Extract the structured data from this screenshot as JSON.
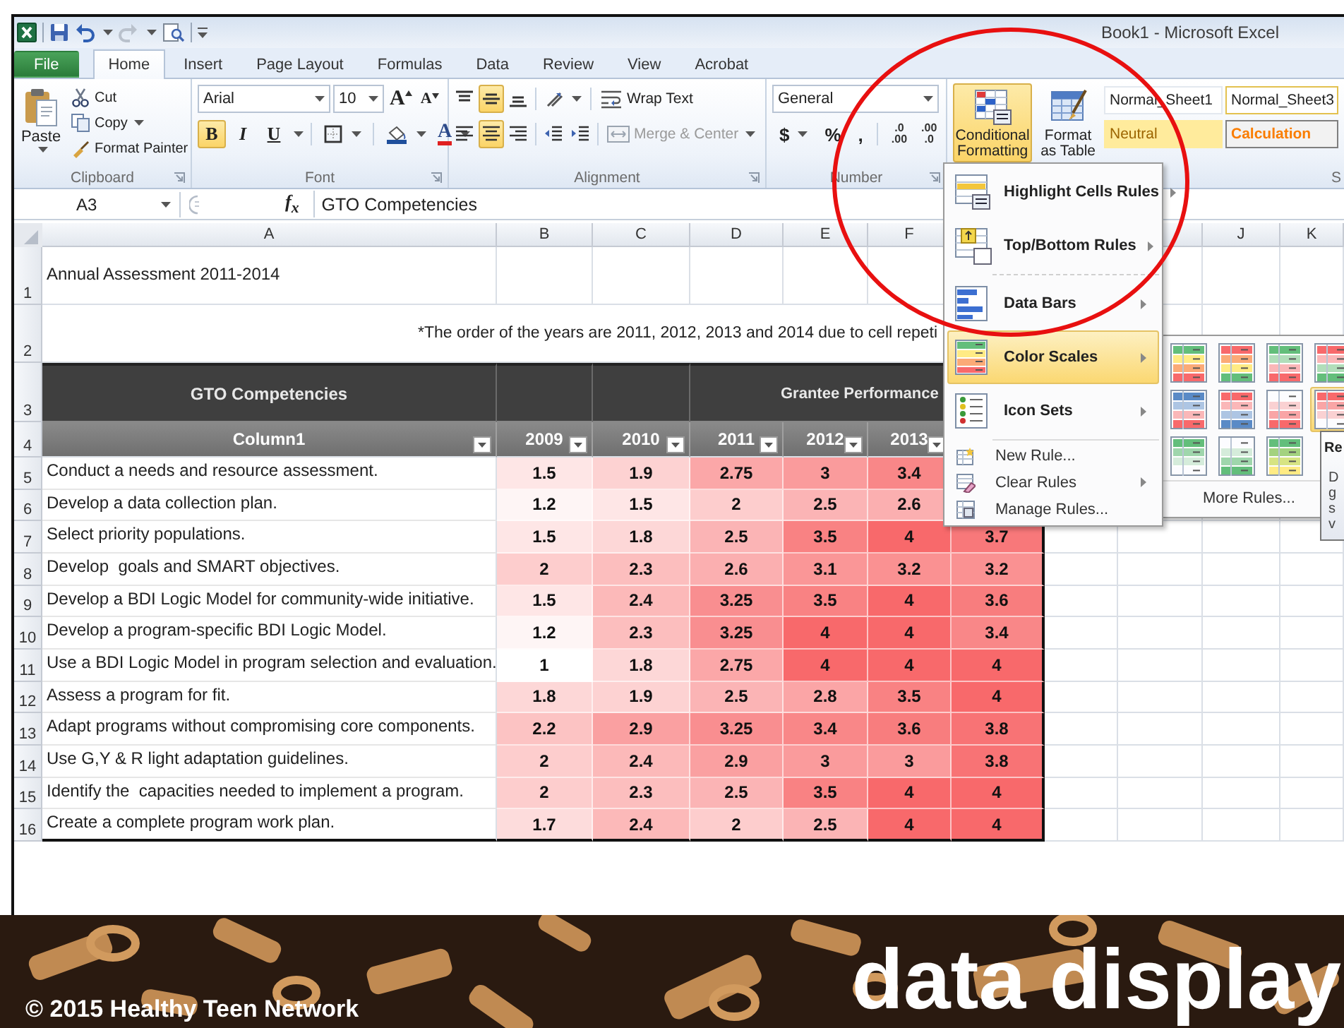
{
  "title_bar": {
    "title": "Book1  -  Microsoft Excel"
  },
  "tabs": [
    {
      "label": "File",
      "kind": "file",
      "selected": false
    },
    {
      "label": "Home",
      "kind": "tab",
      "selected": true
    },
    {
      "label": "Insert",
      "kind": "tab",
      "selected": false
    },
    {
      "label": "Page Layout",
      "kind": "tab",
      "selected": false
    },
    {
      "label": "Formulas",
      "kind": "tab",
      "selected": false
    },
    {
      "label": "Data",
      "kind": "tab",
      "selected": false
    },
    {
      "label": "Review",
      "kind": "tab",
      "selected": false
    },
    {
      "label": "View",
      "kind": "tab",
      "selected": false
    },
    {
      "label": "Acrobat",
      "kind": "tab",
      "selected": false
    }
  ],
  "clipboard": {
    "paste": "Paste",
    "cut": "Cut",
    "copy": "Copy",
    "format_painter": "Format Painter",
    "label": "Clipboard"
  },
  "font": {
    "name": "Arial",
    "size": "10",
    "grow": "A",
    "shrink": "A",
    "bold": {
      "label": "B",
      "on": true
    },
    "italic": {
      "label": "I",
      "on": false
    },
    "underline": {
      "label": "U",
      "on": false
    },
    "font_color": "A",
    "label": "Font"
  },
  "alignment": {
    "vertical": [
      {
        "selected": false
      },
      {
        "selected": true
      },
      {
        "selected": false
      }
    ],
    "horizontal": [
      {
        "selected": false
      },
      {
        "selected": true
      },
      {
        "selected": false
      }
    ],
    "wrap_text": "Wrap Text",
    "merge_center": {
      "label": "Merge & Center",
      "disabled": true
    },
    "label": "Alignment"
  },
  "number": {
    "format": "General",
    "currency": "$",
    "percent": "%",
    "comma": ",",
    "increase_decimal": [
      ".0",
      ".00"
    ],
    "decrease_decimal": [
      ".00",
      ".0"
    ],
    "label": "Number"
  },
  "styles": {
    "conditional_formatting": {
      "label": "Conditional Formatting",
      "active": true
    },
    "format_as_table": "Format as Table",
    "cell_styles": [
      {
        "label": "Normal_Sheet1",
        "kind": "normal",
        "selected": false
      },
      {
        "label": "Normal_Sheet3",
        "kind": "normal",
        "selected": true
      },
      {
        "label": "Neutral",
        "kind": "neutral",
        "selected": false
      },
      {
        "label": "Calculation",
        "kind": "calculation",
        "selected": false
      }
    ],
    "label": "S"
  },
  "formula_bar": {
    "name_box": "A3",
    "function_label": "f$_{x}$",
    "value": "GTO Competencies"
  },
  "column_header_bar": {
    "letters": [
      "A",
      "B",
      "C",
      "D",
      "E",
      "F",
      "J",
      "K"
    ]
  },
  "row_header_bar": {
    "numbers": [
      "1",
      "2",
      "3",
      "4",
      "5",
      "6",
      "7",
      "8",
      "9",
      "10",
      "11",
      "12",
      "13",
      "14",
      "15",
      "16"
    ]
  },
  "sheet": {
    "title": "Annual Assessment 2011-2014",
    "note": "*The order of the years are 2011, 2012, 2013 and 2014 due to cell repeti",
    "group_headers": [
      "GTO Competencies",
      "Grantee Performance"
    ],
    "column_headers": [
      "Column1",
      "2009",
      "2010",
      "2011",
      "2012",
      "2013"
    ],
    "rows": [
      {
        "label": "Conduct a needs and resource assessment.",
        "cells": [
          {
            "value": "1.5",
            "color": "#fee6e6"
          },
          {
            "value": "1.9",
            "color": "#fdd2d2"
          },
          {
            "value": "2.75",
            "color": "#fba7a8"
          },
          {
            "value": "3",
            "color": "#fa9b9c"
          },
          {
            "value": "3.4",
            "color": "#f98788"
          }
        ]
      },
      {
        "label": "Develop a data collection plan.",
        "cells": [
          {
            "value": "1.2",
            "color": "#fef5f5"
          },
          {
            "value": "1.5",
            "color": "#fee6e6"
          },
          {
            "value": "2",
            "color": "#fdcdcd"
          },
          {
            "value": "2.5",
            "color": "#fbb4b5"
          },
          {
            "value": "2.6",
            "color": "#fbafb0"
          }
        ]
      },
      {
        "label": "Select priority populations.",
        "cells": [
          {
            "value": "1.5",
            "color": "#fee6e6"
          },
          {
            "value": "1.8",
            "color": "#fdd7d7"
          },
          {
            "value": "2.5",
            "color": "#fbb4b5"
          },
          {
            "value": "3.5",
            "color": "#f98283"
          },
          {
            "value": "4",
            "color": "#f8696b"
          },
          {
            "value": "3.7",
            "color": "#f8787a"
          }
        ]
      },
      {
        "label": "Develop  goals and SMART objectives.",
        "cells": [
          {
            "value": "2",
            "color": "#fdcdcd"
          },
          {
            "value": "2.3",
            "color": "#fcbebe"
          },
          {
            "value": "2.6",
            "color": "#fbafb0"
          },
          {
            "value": "3.1",
            "color": "#fa9697"
          },
          {
            "value": "3.2",
            "color": "#fa9192"
          },
          {
            "value": "3.2",
            "color": "#fa9192"
          }
        ]
      },
      {
        "label": "Develop a BDI Logic Model for community-wide initiative.",
        "cells": [
          {
            "value": "1.5",
            "color": "#fee6e6"
          },
          {
            "value": "2.4",
            "color": "#fcb9b9"
          },
          {
            "value": "3.25",
            "color": "#f98e90"
          },
          {
            "value": "3.5",
            "color": "#f98283"
          },
          {
            "value": "4",
            "color": "#f8696b"
          },
          {
            "value": "3.6",
            "color": "#f87d7e"
          }
        ]
      },
      {
        "label": "Develop a program-specific BDI Logic Model.",
        "cells": [
          {
            "value": "1.2",
            "color": "#fef5f5"
          },
          {
            "value": "2.3",
            "color": "#fcbebe"
          },
          {
            "value": "3.25",
            "color": "#f98e90"
          },
          {
            "value": "4",
            "color": "#f8696b"
          },
          {
            "value": "4",
            "color": "#f8696b"
          },
          {
            "value": "3.4",
            "color": "#f98788"
          }
        ]
      },
      {
        "label": "Use a BDI Logic Model in program selection and evaluation.",
        "cells": [
          {
            "value": "1",
            "color": "#ffffff"
          },
          {
            "value": "1.8",
            "color": "#fdd7d7"
          },
          {
            "value": "2.75",
            "color": "#fba7a8"
          },
          {
            "value": "4",
            "color": "#f8696b"
          },
          {
            "value": "4",
            "color": "#f8696b"
          },
          {
            "value": "4",
            "color": "#f8696b"
          }
        ]
      },
      {
        "label": "Assess a program for fit.",
        "cells": [
          {
            "value": "1.8",
            "color": "#fdd7d7"
          },
          {
            "value": "1.9",
            "color": "#fdd2d2"
          },
          {
            "value": "2.5",
            "color": "#fbb4b5"
          },
          {
            "value": "2.8",
            "color": "#fba5a6"
          },
          {
            "value": "3.5",
            "color": "#f98283"
          },
          {
            "value": "4",
            "color": "#f8696b"
          }
        ]
      },
      {
        "label": "Adapt programs without compromising core components.",
        "cells": [
          {
            "value": "2.2",
            "color": "#fcc3c3"
          },
          {
            "value": "2.9",
            "color": "#faa0a1"
          },
          {
            "value": "3.25",
            "color": "#f98e90"
          },
          {
            "value": "3.4",
            "color": "#f98788"
          },
          {
            "value": "3.6",
            "color": "#f87d7e"
          },
          {
            "value": "3.8",
            "color": "#f87375"
          }
        ]
      },
      {
        "label": "Use G,Y & R light adaptation guidelines.",
        "cells": [
          {
            "value": "2",
            "color": "#fdcdcd"
          },
          {
            "value": "2.4",
            "color": "#fcb9b9"
          },
          {
            "value": "2.9",
            "color": "#faa0a1"
          },
          {
            "value": "3",
            "color": "#fa9b9c"
          },
          {
            "value": "3",
            "color": "#fa9b9c"
          },
          {
            "value": "3.8",
            "color": "#f87375"
          }
        ]
      },
      {
        "label": "Identify the  capacities needed to implement a program.",
        "cells": [
          {
            "value": "2",
            "color": "#fdcdcd"
          },
          {
            "value": "2.3",
            "color": "#fcbebe"
          },
          {
            "value": "2.5",
            "color": "#fbb4b5"
          },
          {
            "value": "3.5",
            "color": "#f98283"
          },
          {
            "value": "4",
            "color": "#f8696b"
          },
          {
            "value": "4",
            "color": "#f8696b"
          }
        ]
      },
      {
        "label": "Create a complete program work plan.",
        "cells": [
          {
            "value": "1.7",
            "color": "#fddcdc"
          },
          {
            "value": "2.4",
            "color": "#fcb9b9"
          },
          {
            "value": "2",
            "color": "#fdcdcd"
          },
          {
            "value": "2.5",
            "color": "#fbb4b5"
          },
          {
            "value": "4",
            "color": "#f8696b"
          },
          {
            "value": "4",
            "color": "#f8696b"
          }
        ]
      }
    ]
  },
  "menu": {
    "items": [
      {
        "label": "Highlight Cells Rules",
        "kind": "large",
        "submenu": true,
        "selected": false
      },
      {
        "label": "Top/Bottom Rules",
        "kind": "large",
        "submenu": true,
        "selected": false
      },
      {
        "label": "Data Bars",
        "kind": "large",
        "submenu": true,
        "selected": false
      },
      {
        "label": "Color Scales",
        "kind": "large",
        "submenu": true,
        "selected": true
      },
      {
        "label": "Icon Sets",
        "kind": "large",
        "submenu": true,
        "selected": false
      },
      {
        "label": "New Rule...",
        "kind": "small",
        "submenu": false,
        "selected": false
      },
      {
        "label": "Clear Rules",
        "kind": "small",
        "submenu": true,
        "selected": false
      },
      {
        "label": "Manage Rules...",
        "kind": "small",
        "submenu": false,
        "selected": false
      }
    ]
  },
  "submenu": {
    "scales": [
      {
        "selected": false
      },
      {
        "selected": false
      },
      {
        "selected": false
      },
      {
        "selected": false
      },
      {
        "selected": false
      },
      {
        "selected": false
      },
      {
        "selected": false
      },
      {
        "selected": true
      },
      {
        "selected": false
      },
      {
        "selected": false
      },
      {
        "selected": false
      }
    ],
    "more_rules": "More Rules..."
  },
  "tooltip": {
    "title": "Re",
    "lines": [
      "D",
      "g",
      "s",
      "v"
    ]
  },
  "footer": {
    "copyright": "© 2015 Healthy Teen Network",
    "title": "data display"
  }
}
